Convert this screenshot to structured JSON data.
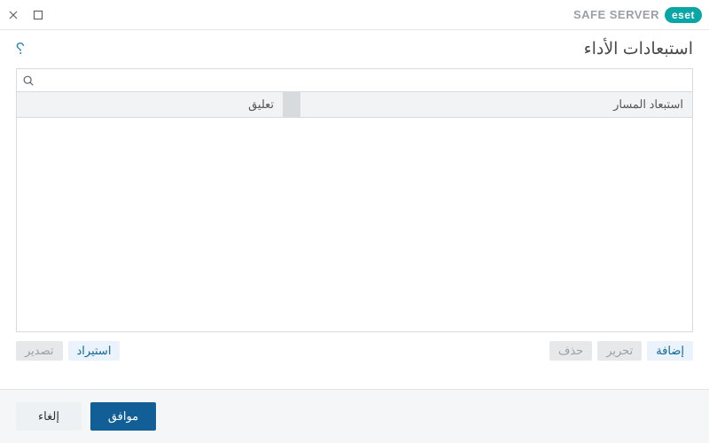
{
  "brand": {
    "badge": "eset",
    "product": "SAFE SERVER"
  },
  "title": "استبعادات الأداء",
  "search": {
    "value": "",
    "placeholder": ""
  },
  "columns": {
    "path": "استبعاد المسار",
    "comment": "تعليق"
  },
  "actions": {
    "add": "إضافة",
    "edit": "تحرير",
    "delete": "حذف",
    "import": "استيراد",
    "export": "تصدير"
  },
  "footer": {
    "ok": "موافق",
    "cancel": "إلغاء"
  }
}
